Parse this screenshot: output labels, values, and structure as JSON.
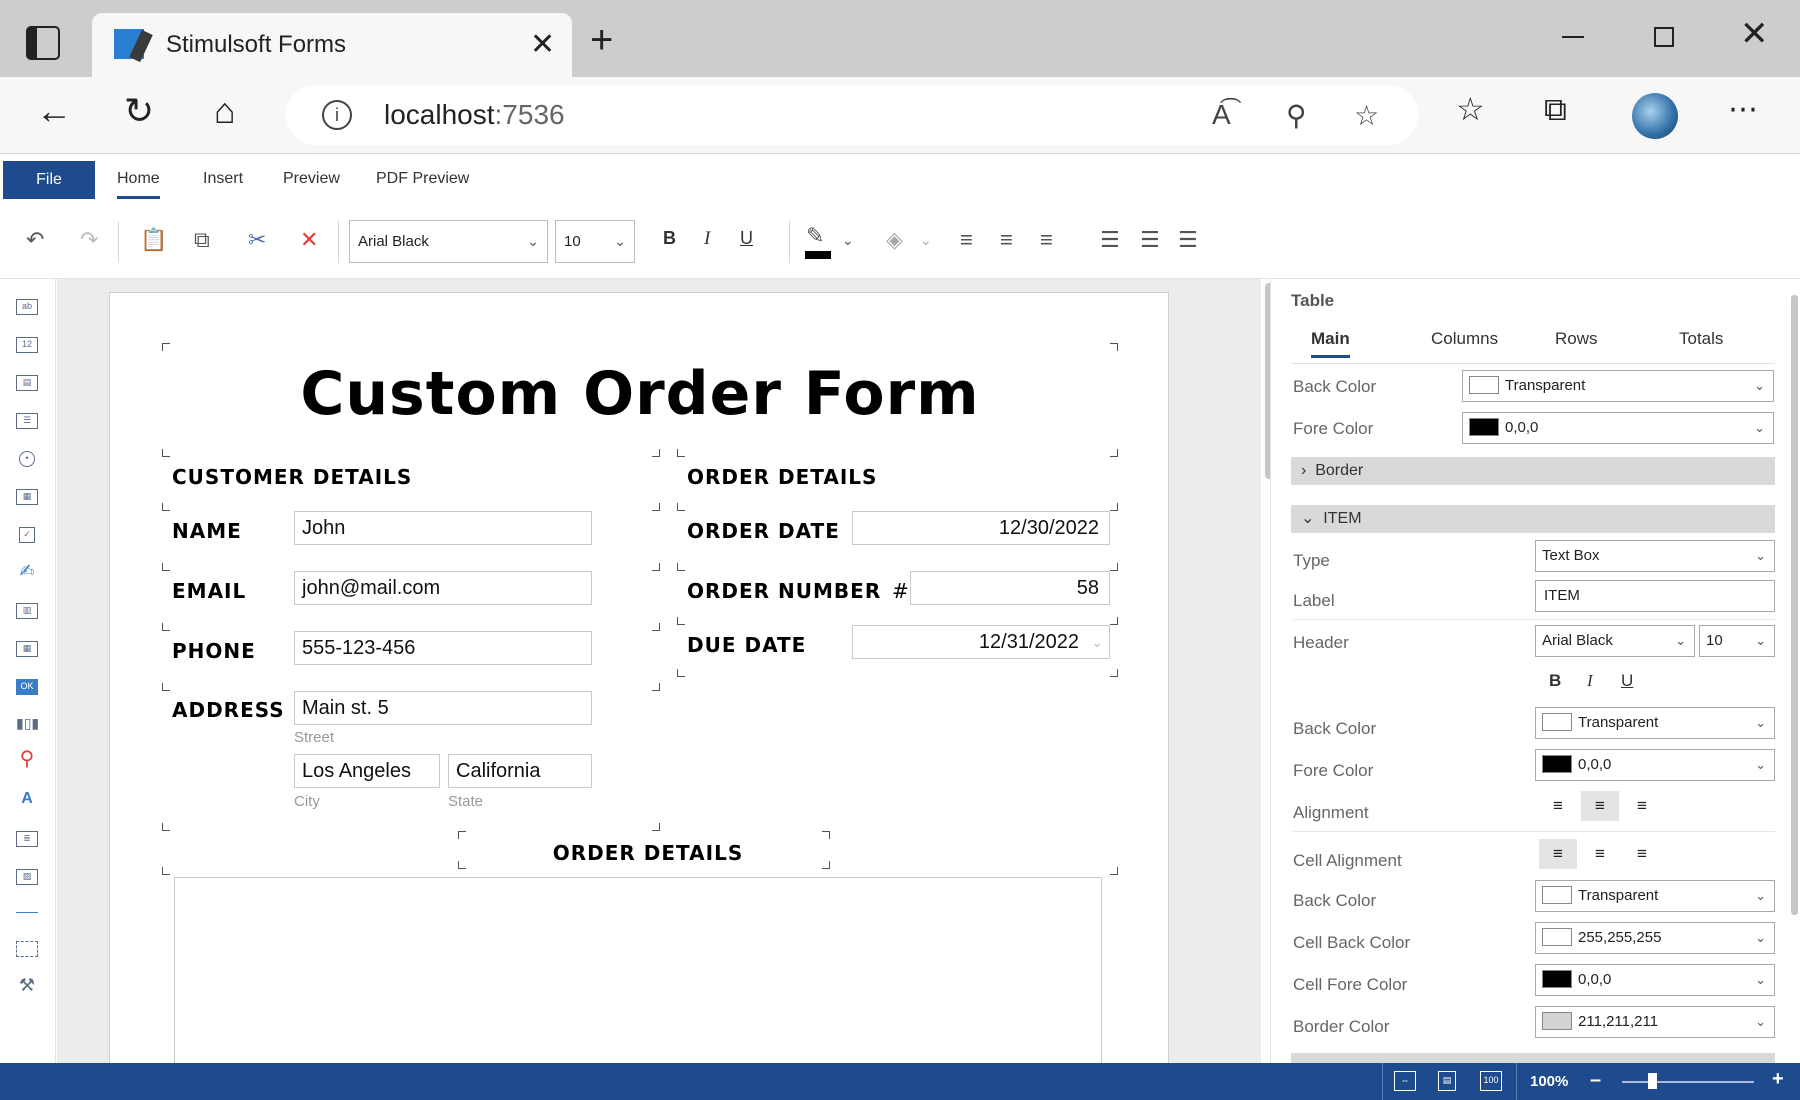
{
  "browser": {
    "tab_title": "Stimulsoft Forms",
    "url_host": "localhost",
    "url_port": ":7536"
  },
  "ribbon": {
    "file": "File",
    "tabs": [
      "Home",
      "Insert",
      "Preview",
      "PDF Preview"
    ],
    "font_family": "Arial Black",
    "font_size": "10",
    "bold": "B",
    "italic": "I",
    "underline": "U"
  },
  "form": {
    "title": "Custom Order Form",
    "customer_heading": "CUSTOMER DETAILS",
    "order_heading": "ORDER DETAILS",
    "name_label": "NAME",
    "name_value": "John",
    "email_label": "EMAIL",
    "email_value": "john@mail.com",
    "phone_label": "PHONE",
    "phone_value": "555-123-456",
    "address_label": "ADDRESS",
    "street_value": "Main st. 5",
    "street_caption": "Street",
    "city_value": "Los Angeles",
    "city_caption": "City",
    "state_value": "California",
    "state_caption": "State",
    "order_date_label": "ORDER DATE",
    "order_date_value": "12/30/2022",
    "order_number_label": "ORDER NUMBER",
    "order_number_hash": "#",
    "order_number_value": "58",
    "due_date_label": "DUE DATE",
    "due_date_value": "12/31/2022",
    "table_heading": "ORDER DETAILS"
  },
  "panel": {
    "title": "Table",
    "tabs": [
      "Main",
      "Columns",
      "Rows",
      "Totals"
    ],
    "back_color_label": "Back Color",
    "back_color_value": "Transparent",
    "fore_color_label": "Fore Color",
    "fore_color_value": "0,0,0",
    "border_group": "Border",
    "item_group": "ITEM",
    "type_label": "Type",
    "type_value": "Text Box",
    "label_label": "Label",
    "label_value": "ITEM",
    "header_label": "Header",
    "header_font": "Arial Black",
    "header_size": "10",
    "header_back_label": "Back Color",
    "header_back_value": "Transparent",
    "header_fore_label": "Fore Color",
    "header_fore_value": "0,0,0",
    "alignment_label": "Alignment",
    "cell_alignment_label": "Cell Alignment",
    "cell_back_label": "Back Color",
    "cell_back_value": "Transparent",
    "cell_back_color_label": "Cell Back Color",
    "cell_back_color_value": "255,255,255",
    "cell_fore_color_label": "Cell Fore Color",
    "cell_fore_color_value": "0,0,0",
    "border_color_label": "Border Color",
    "border_color_value": "211,211,211"
  },
  "status": {
    "zoom": "100%",
    "zoom_minus": "–",
    "zoom_plus": "+"
  },
  "colors": {
    "accent": "#1e4b8e",
    "swatch_black": "#000000",
    "swatch_gray": "#d3d3d3",
    "swatch_white": "#ffffff"
  }
}
